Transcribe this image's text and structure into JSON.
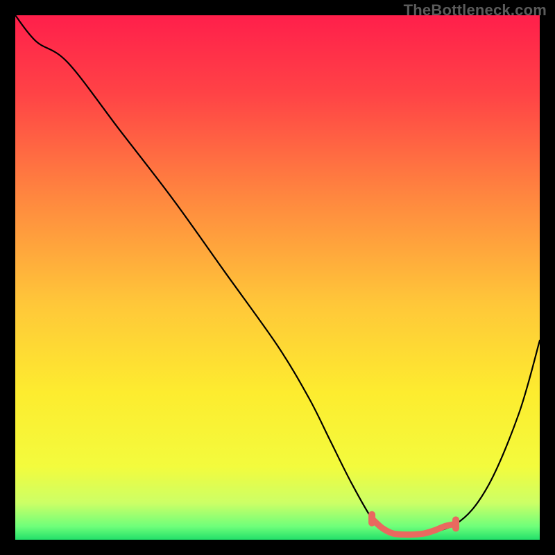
{
  "watermark": "TheBottleneck.com",
  "chart_data": {
    "type": "line",
    "title": "",
    "xlabel": "",
    "ylabel": "",
    "xlim": [
      0,
      100
    ],
    "ylim": [
      0,
      100
    ],
    "grid": false,
    "legend": false,
    "series": [
      {
        "name": "bottleneck-curve",
        "color": "#000000",
        "x": [
          0,
          4,
          10,
          20,
          30,
          40,
          50,
          56,
          60,
          64,
          68,
          70,
          72,
          76,
          84,
          90,
          96,
          100
        ],
        "y": [
          100,
          95,
          91,
          78,
          65,
          51,
          37,
          27,
          19,
          11,
          4,
          2,
          1,
          1,
          3,
          10,
          24,
          38
        ]
      }
    ],
    "highlight": {
      "name": "optimal-range",
      "color": "#e9695f",
      "x": [
        68,
        70,
        72,
        74,
        76,
        78,
        80,
        82,
        84
      ],
      "y": [
        4,
        2.2,
        1.2,
        1,
        1,
        1.2,
        1.8,
        2.6,
        3
      ]
    },
    "gradient_stops": [
      {
        "offset": 0.0,
        "color": "#ff1f4b"
      },
      {
        "offset": 0.15,
        "color": "#ff4346"
      },
      {
        "offset": 0.35,
        "color": "#ff883f"
      },
      {
        "offset": 0.55,
        "color": "#ffc739"
      },
      {
        "offset": 0.72,
        "color": "#fdec2f"
      },
      {
        "offset": 0.86,
        "color": "#f3fb3d"
      },
      {
        "offset": 0.93,
        "color": "#ccff66"
      },
      {
        "offset": 0.975,
        "color": "#6eff7a"
      },
      {
        "offset": 1.0,
        "color": "#22e06a"
      }
    ]
  }
}
